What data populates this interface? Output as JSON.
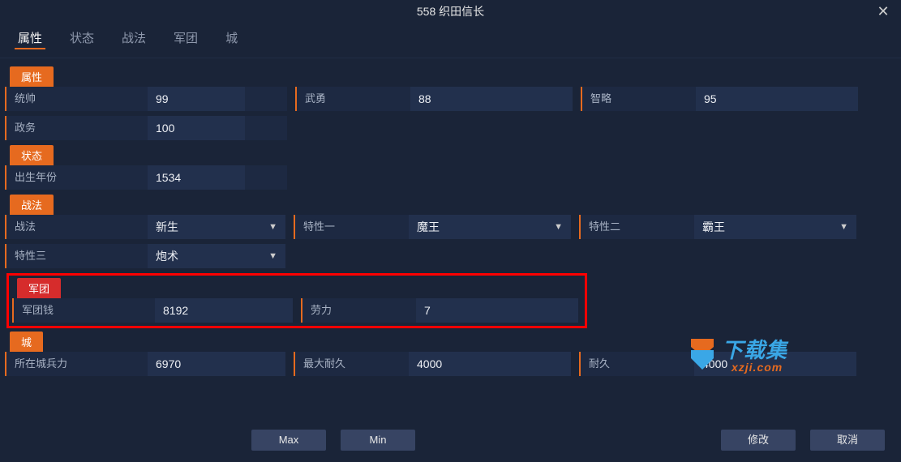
{
  "title": "558 织田信长",
  "tabs": [
    "属性",
    "状态",
    "战法",
    "军团",
    "城"
  ],
  "active_tab_index": 0,
  "sections": {
    "attributes": {
      "header": "属性",
      "leadership": {
        "label": "统帅",
        "value": "99"
      },
      "valor": {
        "label": "武勇",
        "value": "88"
      },
      "intellect": {
        "label": "智略",
        "value": "95"
      },
      "politics": {
        "label": "政务",
        "value": "100"
      }
    },
    "status": {
      "header": "状态",
      "birth_year": {
        "label": "出生年份",
        "value": "1534"
      }
    },
    "tactics": {
      "header": "战法",
      "tactic": {
        "label": "战法",
        "value": "新生"
      },
      "trait1": {
        "label": "特性一",
        "value": "魔王"
      },
      "trait2": {
        "label": "特性二",
        "value": "霸王"
      },
      "trait3": {
        "label": "特性三",
        "value": "炮术"
      }
    },
    "army": {
      "header": "军团",
      "money": {
        "label": "军团钱",
        "value": "8192"
      },
      "labor": {
        "label": "劳力",
        "value": "7"
      }
    },
    "castle": {
      "header": "城",
      "troops": {
        "label": "所在城兵力",
        "value": "6970"
      },
      "max_durab": {
        "label": "最大耐久",
        "value": "4000"
      },
      "durability": {
        "label": "耐久",
        "value": "4000"
      }
    }
  },
  "buttons": {
    "max": "Max",
    "min": "Min",
    "modify": "修改",
    "cancel": "取消"
  },
  "watermark": {
    "line1": "下载集",
    "line2": "xzji.com"
  }
}
